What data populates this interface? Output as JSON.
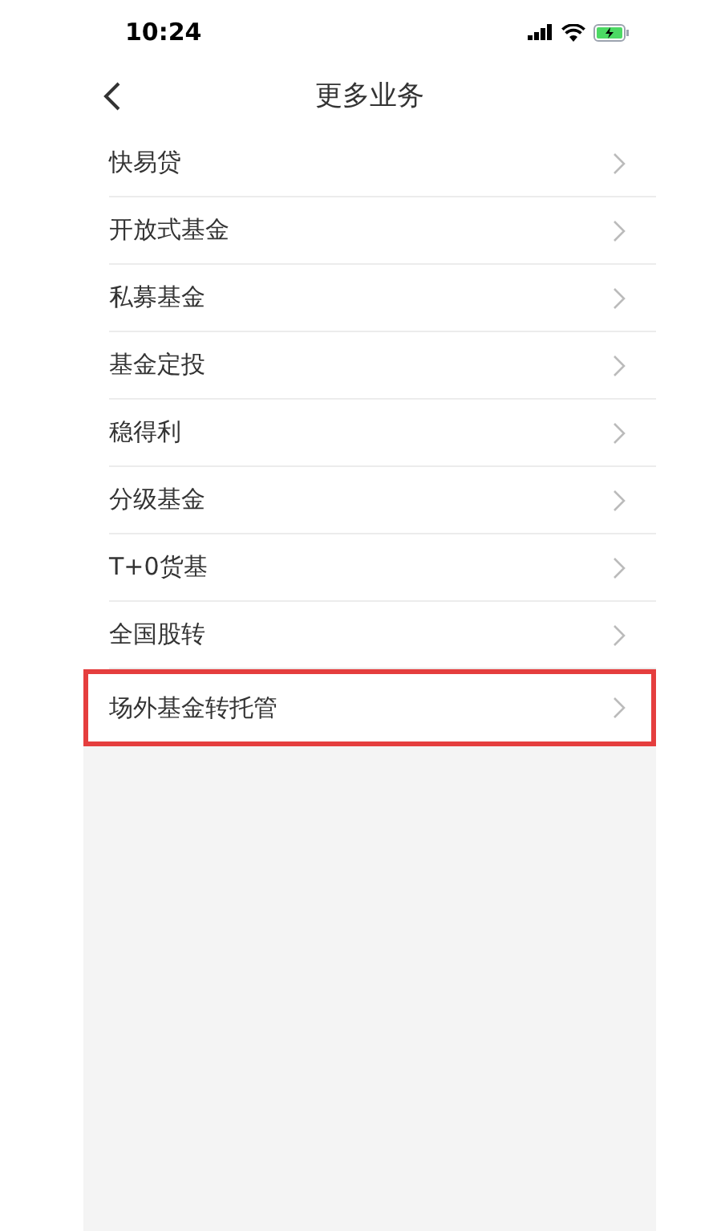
{
  "status_bar": {
    "time": "10:24"
  },
  "nav_bar": {
    "title": "更多业务"
  },
  "items": [
    {
      "label": "快易贷",
      "highlighted": false
    },
    {
      "label": "开放式基金",
      "highlighted": false
    },
    {
      "label": "私募基金",
      "highlighted": false
    },
    {
      "label": "基金定投",
      "highlighted": false
    },
    {
      "label": "稳得利",
      "highlighted": false
    },
    {
      "label": "分级基金",
      "highlighted": false
    },
    {
      "label": "T+0货基",
      "highlighted": false
    },
    {
      "label": "全国股转",
      "highlighted": false
    },
    {
      "label": "场外基金转托管",
      "highlighted": true
    }
  ]
}
